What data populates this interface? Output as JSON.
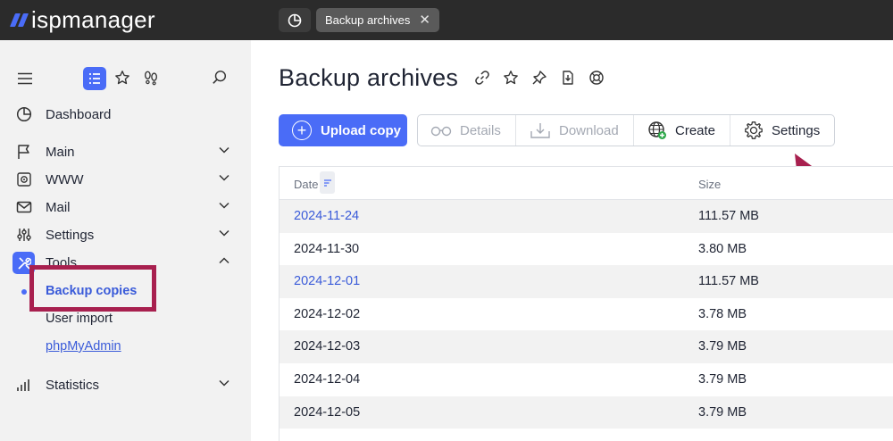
{
  "app": {
    "logo_text": "ispmanager",
    "tab_label": "Backup archives",
    "tab_close": "✕"
  },
  "sidebar": {
    "icons": [
      "hamburger-icon",
      "list-icon",
      "star-icon",
      "footprints-icon",
      "search-icon"
    ],
    "items": [
      {
        "label": "Dashboard",
        "icon": "dashboard-icon"
      },
      {
        "label": "Main",
        "icon": "flag-icon"
      },
      {
        "label": "WWW",
        "icon": "www-gear-icon"
      },
      {
        "label": "Mail",
        "icon": "mail-icon"
      },
      {
        "label": "Settings",
        "icon": "sliders-icon"
      },
      {
        "label": "Tools",
        "icon": "tools-icon"
      },
      {
        "label": "Statistics",
        "icon": "bar-chart-icon"
      }
    ],
    "tools_sub": [
      {
        "label": "Backup copies",
        "active": true
      },
      {
        "label": "User import"
      },
      {
        "label": "phpMyAdmin"
      }
    ]
  },
  "page": {
    "title": "Backup archives",
    "title_icons": [
      "link-icon",
      "star-icon",
      "pin-icon",
      "download-file-icon",
      "help-ring-icon"
    ]
  },
  "toolbar": {
    "upload_label": "Upload copy",
    "details_label": "Details",
    "download_label": "Download",
    "create_label": "Create",
    "settings_label": "Settings"
  },
  "table": {
    "columns": [
      "Date",
      "Size"
    ],
    "rows": [
      {
        "date": "2024-11-24",
        "size": "111.57 MB",
        "link": true
      },
      {
        "date": "2024-11-30",
        "size": "3.80 MB",
        "link": false
      },
      {
        "date": "2024-12-01",
        "size": "111.57 MB",
        "link": true
      },
      {
        "date": "2024-12-02",
        "size": "3.78 MB",
        "link": false
      },
      {
        "date": "2024-12-03",
        "size": "3.79 MB",
        "link": false
      },
      {
        "date": "2024-12-04",
        "size": "3.79 MB",
        "link": false
      },
      {
        "date": "2024-12-05",
        "size": "3.79 MB",
        "link": false
      }
    ]
  },
  "colors": {
    "accent": "#4a6cf7",
    "annotation": "#a8204f",
    "topbar": "#2b2b2b",
    "sidebar": "#f2f2f2"
  }
}
